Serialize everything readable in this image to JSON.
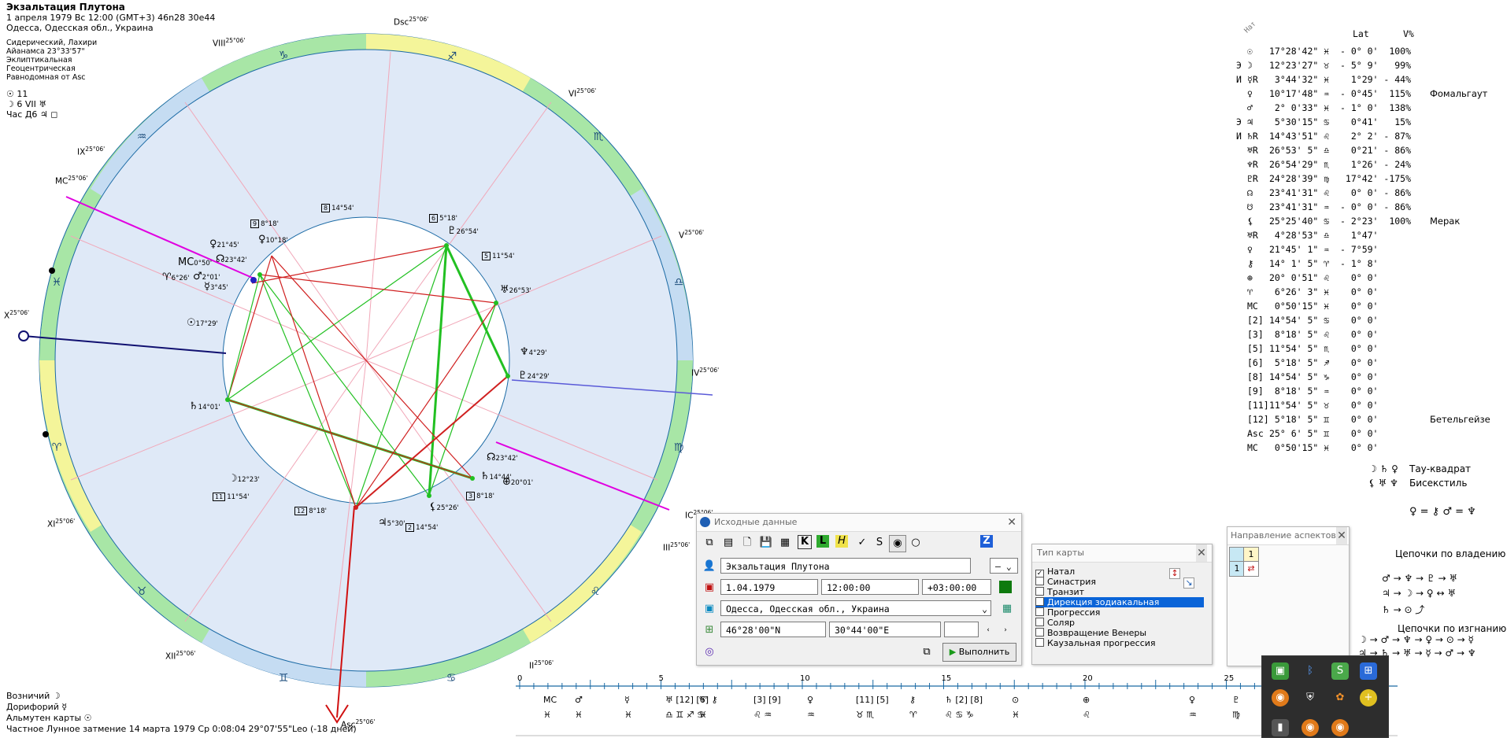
{
  "header": {
    "title": "Экзальтация Плутона",
    "date_line": "1 апреля 1979  Вс  12:00 (GMT+3) 46n28  30e44",
    "place_line": "Одесса, Одесская обл., Украина",
    "settings": [
      "Сидерический, Лахири",
      "Айанамса 23°33'57\"",
      "Эклиптикальная",
      "Геоцентрическая",
      "Равнодомная от Asc"
    ],
    "sun_line": "☉  11",
    "moon_line": "☽  6 VII ♅",
    "hour_line": "Час Д6 ♃ ◻"
  },
  "footer": {
    "vozn": "Возничий ☽",
    "dorif": "Дорифорий ☿",
    "almuten": "Альмутен карты ☉",
    "eclipse": "Частное Лунное затмение 14 марта 1979 Ср  0:08:04 29°07'55\"Leo (-18 дней)"
  },
  "houses": {
    "cusps": [
      {
        "label": "Asc",
        "deg": "25°06'"
      },
      {
        "label": "II",
        "deg": "25°06'"
      },
      {
        "label": "III",
        "deg": "25°06'"
      },
      {
        "label": "IC",
        "deg": "25°06'"
      },
      {
        "label": "V",
        "deg": "25°06'"
      },
      {
        "label": "VI",
        "deg": "25°06'"
      },
      {
        "label": "Dsc",
        "deg": "25°06'"
      },
      {
        "label": "VIII",
        "deg": "25°06'"
      },
      {
        "label": "IX",
        "deg": "25°06'"
      },
      {
        "label": "MC",
        "deg": "25°06'"
      },
      {
        "label": "XI",
        "deg": "25°06'"
      },
      {
        "label": "XII",
        "deg": "25°06'"
      },
      {
        "label": "IV",
        "deg": "25°06'"
      },
      {
        "label": "X",
        "deg": "25°06'"
      }
    ]
  },
  "chart_planets": [
    {
      "glyph": "☉",
      "label": "17°29'"
    },
    {
      "glyph": "♀",
      "label": "21°45'"
    },
    {
      "glyph": "☊",
      "label": "23°42'"
    },
    {
      "glyph": "♀",
      "label": "10°18'"
    },
    {
      "glyph": "♂",
      "label": "2°01'"
    },
    {
      "glyph": "☿",
      "label": "3°45'"
    },
    {
      "glyph": "MC",
      "label": "0°50'"
    },
    {
      "glyph": "♈",
      "label": "6°26'"
    },
    {
      "glyph": "♄",
      "label": "14°01'"
    },
    {
      "glyph": "☽",
      "label": "12°23'"
    },
    {
      "glyph": "♇",
      "label": "26°54'"
    },
    {
      "glyph": "♅",
      "label": "26°53'"
    },
    {
      "glyph": "♆",
      "label": "4°29'"
    },
    {
      "glyph": "♇",
      "label": "24°29'"
    },
    {
      "glyph": "☊",
      "label": "23°42'"
    },
    {
      "glyph": "♄",
      "label": "14°44'"
    },
    {
      "glyph": "⊕",
      "label": "20°01'"
    },
    {
      "glyph": "♃",
      "label": "5°30'"
    },
    {
      "glyph": "⚸",
      "label": "25°26'"
    }
  ],
  "chart_house_marks": [
    {
      "n": "8",
      "label": "14°54'"
    },
    {
      "n": "6",
      "label": "5°18'"
    },
    {
      "n": "9",
      "label": "8°18'"
    },
    {
      "n": "5",
      "label": "11°54'"
    },
    {
      "n": "3",
      "label": "8°18'"
    },
    {
      "n": "2",
      "label": "14°54'"
    },
    {
      "n": "12",
      "label": "8°18'"
    },
    {
      "n": "11",
      "label": "11°54'"
    }
  ],
  "table": {
    "header_nat": "Нат",
    "header_lat": "Lat",
    "header_v": "V%",
    "rows": [
      {
        "pre": "",
        "glyph": "☉",
        "text": "17°28'42\" ♓  - 0° 0'  100%",
        "star": ""
      },
      {
        "pre": "Э",
        "glyph": "☽",
        "text": "12°23'27\" ♉  - 5° 9'   99%",
        "star": ""
      },
      {
        "pre": "И",
        "glyph": "☿R",
        "text": " 3°44'32\" ♓    1°29' - 44%",
        "star": ""
      },
      {
        "pre": "",
        "glyph": "♀",
        "text": "10°17'48\" ♒  - 0°45'  115%",
        "star": "Фомальгаут"
      },
      {
        "pre": "",
        "glyph": "♂",
        "text": " 2° 0'33\" ♓  - 1° 0'  138%",
        "star": ""
      },
      {
        "pre": "Э",
        "glyph": "♃",
        "text": " 5°30'15\" ♋    0°41'   15%",
        "star": ""
      },
      {
        "pre": "И",
        "glyph": "♄R",
        "text": "14°43'51\" ♌    2° 2' - 87%",
        "star": ""
      },
      {
        "pre": "",
        "glyph": "♅R",
        "text": "26°53' 5\" ♎    0°21' - 86%",
        "star": ""
      },
      {
        "pre": "",
        "glyph": "♆R",
        "text": "26°54'29\" ♏    1°26' - 24%",
        "star": ""
      },
      {
        "pre": "",
        "glyph": "♇R",
        "text": "24°28'39\" ♍   17°42' -175%",
        "star": ""
      },
      {
        "pre": "",
        "glyph": "☊",
        "text": "23°41'31\" ♌    0° 0' - 86%",
        "star": ""
      },
      {
        "pre": "",
        "glyph": "☋",
        "text": "23°41'31\" ♒  - 0° 0' - 86%",
        "star": ""
      },
      {
        "pre": "",
        "glyph": "⚸",
        "text": "25°25'40\" ♋  - 2°23'  100%",
        "star": "Мерак"
      },
      {
        "pre": "",
        "glyph": "♅R",
        "text": " 4°28'53\" ♎    1°47'",
        "star": ""
      },
      {
        "pre": "",
        "glyph": "♀",
        "text": "21°45' 1\" ♒  - 7°59'",
        "star": ""
      },
      {
        "pre": "",
        "glyph": "⚷",
        "text": "14° 1' 5\" ♈  - 1° 8'",
        "star": ""
      },
      {
        "pre": "",
        "glyph": "⊕",
        "text": "20° 0'51\" ♌    0° 0'",
        "star": ""
      },
      {
        "pre": "",
        "glyph": "♈",
        "text": " 6°26' 3\" ♓    0° 0'",
        "star": ""
      },
      {
        "pre": "",
        "glyph": "MC",
        "text": " 0°50'15\" ♓    0° 0'",
        "star": ""
      },
      {
        "pre": "",
        "glyph": "[2]",
        "text": "14°54' 5\" ♋    0° 0'",
        "star": ""
      },
      {
        "pre": "",
        "glyph": "[3]",
        "text": " 8°18' 5\" ♌    0° 0'",
        "star": ""
      },
      {
        "pre": "",
        "glyph": "[5]",
        "text": "11°54' 5\" ♏    0° 0'",
        "star": ""
      },
      {
        "pre": "",
        "glyph": "[6]",
        "text": " 5°18' 5\" ♐    0° 0'",
        "star": ""
      },
      {
        "pre": "",
        "glyph": "[8]",
        "text": "14°54' 5\" ♑    0° 0'",
        "star": ""
      },
      {
        "pre": "",
        "glyph": "[9]",
        "text": " 8°18' 5\" ♒    0° 0'",
        "star": ""
      },
      {
        "pre": "",
        "glyph": "[11]",
        "text": "11°54' 5\" ♉    0° 0'",
        "star": ""
      },
      {
        "pre": "",
        "glyph": "[12]",
        "text": " 5°18' 5\" ♊    0° 0'",
        "star": "Бетельгейзе"
      },
      {
        "pre": "",
        "glyph": "Asc",
        "text": "25° 6' 5\" ♊    0° 0'",
        "star": ""
      },
      {
        "pre": "",
        "glyph": "MC",
        "text": " 0°50'15\" ♓    0° 0'",
        "star": ""
      }
    ]
  },
  "aspect_figures": [
    {
      "glyphs": "☽ ♄ ♀",
      "name": "Тау-квадрат"
    },
    {
      "glyphs": "⚸ ♅ ♆",
      "name": "Бисекстиль"
    }
  ],
  "equation": "♀ = ⚷  ♂ = ♆",
  "chains": {
    "owner_title": "Цепочки по владению",
    "owner_lines": [
      "♂ → ♆ → ♇ → ♅",
      "♃ → ☽ → ♀ ↔ ♅",
      "♄ → ⊙ ⤴"
    ],
    "exile_title": "Цепочки по изгнанию",
    "exile_lines": [
      "☽ → ♂ → ♆ → ♀ → ⊙ → ☿",
      "♃ → ♄ → ♅ → ☿ → ♂ → ♆"
    ]
  },
  "dialog_input": {
    "title": "Исходные данные",
    "name_value": "Экзальтация Плутона",
    "gender_value": "–",
    "date_value": "1.04.1979",
    "time_value": "12:00:00",
    "tz_value": "+03:00:00",
    "place_value": "Одесса, Одесская обл., Украина",
    "lat_value": "46°28'00\"N",
    "lon_value": "30°44'00\"E",
    "run_label": "Выполнить"
  },
  "dialog_type": {
    "title": "Тип карты",
    "options": [
      {
        "label": "Натал",
        "checked": true,
        "selected": false
      },
      {
        "label": "Синастрия",
        "checked": false,
        "selected": false
      },
      {
        "label": "Транзит",
        "checked": false,
        "selected": false
      },
      {
        "label": "Дирекция зодиакальная",
        "checked": false,
        "selected": true
      },
      {
        "label": "Прогрессия",
        "checked": false,
        "selected": false
      },
      {
        "label": "Соляр",
        "checked": false,
        "selected": false
      },
      {
        "label": "Возвращение Венеры",
        "checked": false,
        "selected": false
      },
      {
        "label": "Каузальная прогрессия",
        "checked": false,
        "selected": false
      }
    ]
  },
  "dialog_aspect_dir": {
    "title": "Направление аспектов",
    "cell_a": "1",
    "cell_b": "1"
  },
  "timeline": {
    "ticks": [
      "0",
      "5",
      "10",
      "15",
      "20",
      "25"
    ],
    "top_glyphs": [
      "MC",
      "♂",
      "☿",
      "♅ [12] [6] ⚷",
      "♈",
      "[3] [9]",
      "♀",
      "[11] [5]",
      "⚷",
      "♄ [2] [8]",
      "⊙",
      "⊕",
      "♀",
      "♇"
    ],
    "bottom_glyphs": [
      "♓",
      "♓",
      "♓",
      "♎ ♊ ♐ ♋",
      "♓",
      "♌ ♒",
      "♒",
      "♉ ♏",
      "♈",
      "♌ ♋ ♑",
      "♓",
      "♌",
      "♒",
      "♍"
    ]
  },
  "colors": {
    "wheel_bg": "#dfe9f7",
    "ring_green": "#a8e6a6",
    "ring_yellow": "#f4f59a",
    "ring_blue": "#c5dcf2",
    "asc_arrow": "#d01010",
    "mc_line": "#e000e0",
    "x_line": "#101070",
    "trine_green": "#22c022",
    "square_red": "#d02020",
    "selection": "#0a64d8"
  }
}
